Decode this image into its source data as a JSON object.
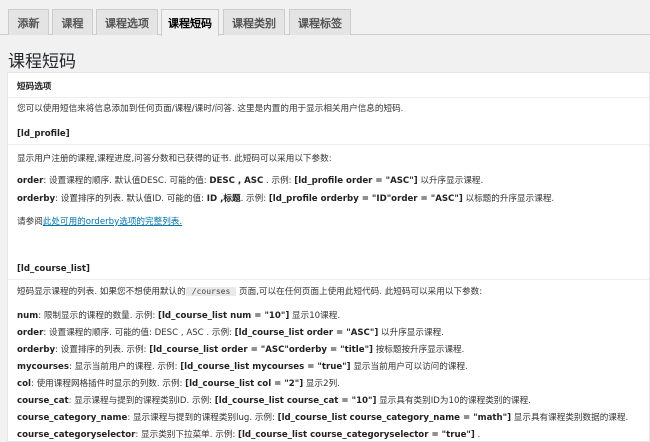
{
  "tabs": [
    {
      "label": "添新",
      "active": false
    },
    {
      "label": "课程",
      "active": false
    },
    {
      "label": "课程选项",
      "active": false
    },
    {
      "label": "课程短码",
      "active": true
    },
    {
      "label": "课程类别",
      "active": false
    },
    {
      "label": "课程标签",
      "active": false
    }
  ],
  "page": {
    "title": "课程短码"
  },
  "panel": {
    "heading": "短码选项",
    "intro": "您可以使用短信来将信息添加到任何页面/课程/课时/问答. 这里是内置的用于显示相关用户信息的短码.",
    "ld_profile": {
      "title": "[ld_profile]",
      "desc": "显示用户注册的课程,课程进度,问答分数和已获得的证书. 此短码可以采用以下参数:",
      "order": {
        "key": "order",
        "pre": ": 设置课程的顺序. 默认值DESC. 可能的值: ",
        "vals": "DESC , ASC",
        "mid": " . 示例: ",
        "example": "[ld_profile order = \"ASC\"]",
        "post": " 以升序显示课程."
      },
      "orderby": {
        "key": "orderby",
        "pre": ": 设置排序的列表. 默认值ID. 可能的值: ",
        "vals": "ID ,标题",
        "mid": ". 示例: ",
        "example": "[ld_profile orderby = \"ID\"order = \"ASC\"]",
        "post": " 以标题的升序显示课程."
      },
      "ref_pre": "请参阅",
      "ref_link": "此处可用的orderby选项的完整列表."
    },
    "ld_course_list": {
      "title": "[ld_course_list]",
      "desc_pre": "短码显示课程的列表. 如果您不想使用默认的",
      "desc_code": "/courses",
      "desc_post": " 页面,可以在任何页面上使用此短代码. 此短码可以采用以下参数:",
      "params": [
        {
          "key": "num",
          "desc": ": 限制显示的课程的数量. 示例: ",
          "example": "[ld_course_list num = \"10\"]",
          "post": " 显示10课程."
        },
        {
          "key": "order",
          "desc": ": 设置课程的顺序. 可能的值: DESC , ASC . 示例: ",
          "example": "[ld_course_list order = \"ASC\"]",
          "post": " 以升序显示课程."
        },
        {
          "key": "orderby",
          "desc": ": 设置排序的列表. 示例: ",
          "example": "[ld_course_list order = \"ASC\"orderby = \"title\"]",
          "post": " 按标题按升序显示课程."
        },
        {
          "key": "mycourses",
          "desc": ": 显示当前用户的课程. 示例: ",
          "example": "[ld_course_list mycourses = \"true\"]",
          "post": " 显示当前用户可以访问的课程."
        },
        {
          "key": "col",
          "desc": ": 使用课程网格插件时显示的列数. 示例: ",
          "example": "[ld_course_list col = \"2\"]",
          "post": " 显示2列."
        },
        {
          "key": "course_cat",
          "desc": ": 显示课程与提到的课程类别ID. 示例: ",
          "example": "[ld_course_list course_cat = \"10\"]",
          "post": " 显示具有类别ID为10的课程类别的课程."
        },
        {
          "key": "course_category_name",
          "desc": ": 显示课程与提到的课程类别lug. 示例: ",
          "example": "[ld_course_list course_category_name = \"math\"]",
          "post": " 显示具有课程类别数据的课程."
        },
        {
          "key": "course_categoryselector",
          "desc": ": 显示类别下拉菜单. 示例: ",
          "example": "[ld_course_list course_categoryselector = \"true\"]",
          "post": " ."
        }
      ]
    }
  }
}
